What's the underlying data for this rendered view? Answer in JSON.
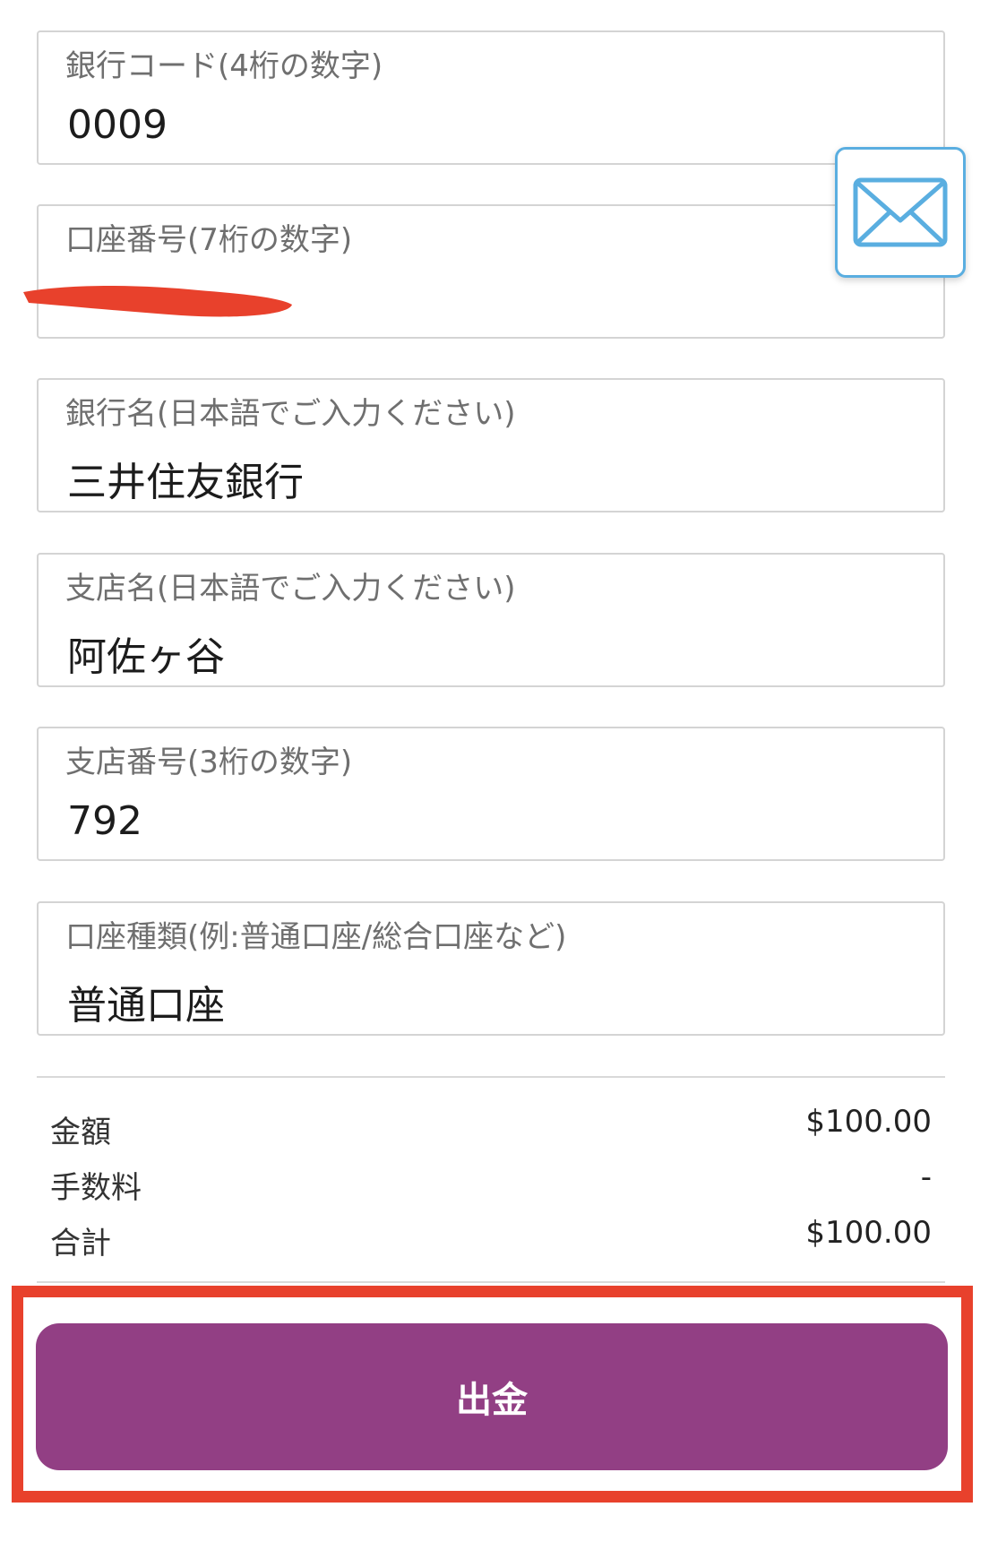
{
  "form": {
    "fields": [
      {
        "label": "銀行コード(4桁の数字)",
        "value": "0009"
      },
      {
        "label": "口座番号(7桁の数字)",
        "value": ""
      },
      {
        "label": "銀行名(日本語でご入力ください)",
        "value": "三井住友銀行"
      },
      {
        "label": "支店名(日本語でご入力ください)",
        "value": "阿佐ヶ谷"
      },
      {
        "label": "支店番号(3桁の数字)",
        "value": "792"
      },
      {
        "label": "口座種類(例:普通口座/総合口座など)",
        "value": "普通口座"
      }
    ]
  },
  "mail_button": {
    "icon": "envelope-icon",
    "color": "#5aaee0"
  },
  "summary": {
    "amount_label": "金額",
    "amount_value": "$100.00",
    "fee_label": "手数料",
    "fee_value": "-",
    "total_label": "合計",
    "total_value": "$100.00"
  },
  "action": {
    "withdraw_label": "出金",
    "button_color": "#923f84",
    "highlight_color": "#e8412c"
  }
}
